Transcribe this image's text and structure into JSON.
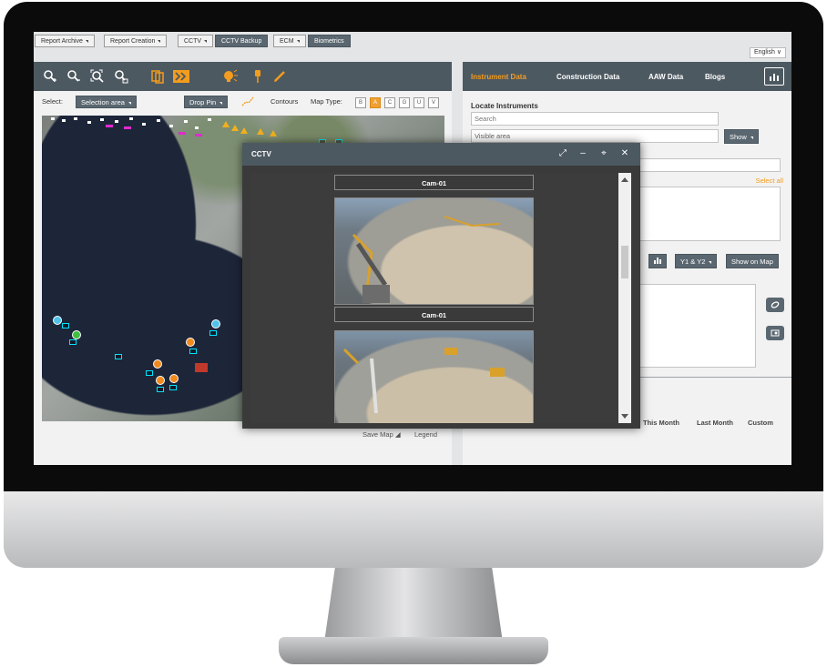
{
  "nav": {
    "report_archive": "Report Archive",
    "report_creation": "Report Creation",
    "cctv": "CCTV",
    "cctv_backup": "CCTV Backup",
    "ecm": "ECM",
    "biometrics": "Biometrics",
    "language": "English"
  },
  "map_panel": {
    "select_label": "Select:",
    "selection_area": "Selection area",
    "drop_pin": "Drop Pin",
    "contours": "Contours",
    "map_type_label": "Map Type:",
    "map_types": [
      "B",
      "A",
      "C",
      "G",
      "U",
      "V"
    ],
    "map_type_selected": "A",
    "save_map": "Save Map",
    "legend": "Legend"
  },
  "right_panel": {
    "tabs": [
      "Instrument Data",
      "Construction Data",
      "AAW Data",
      "Blogs"
    ],
    "active_tab": "Instrument Data",
    "locate_title": "Locate Instruments",
    "search_placeholder": "Search",
    "visible_area": "Visible area",
    "show_button": "Show",
    "select_all": "Select all",
    "y_axis_button": "Y1 & Y2",
    "show_on_map": "Show on Map",
    "ranges": [
      "This Month",
      "Last Month",
      "Custom"
    ]
  },
  "cctv_modal": {
    "title": "CCTV",
    "cameras": [
      "Cam-01",
      "Cam-01"
    ]
  },
  "colors": {
    "accent": "#f39c1e",
    "toolbar": "#4d5961",
    "button": "#5a6770"
  }
}
